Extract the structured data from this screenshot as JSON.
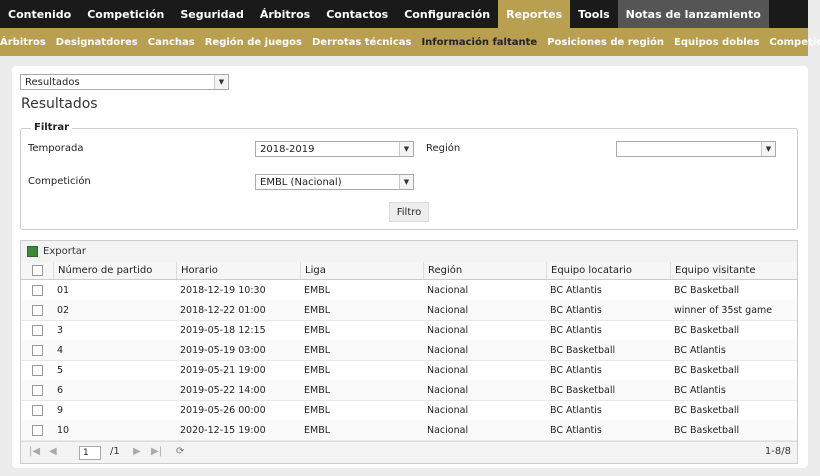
{
  "topnav": [
    "Contenido",
    "Competición",
    "Seguridad",
    "Árbitros",
    "Contactos",
    "Configuración",
    "Reportes",
    "Tools",
    "Notas de lanzamiento"
  ],
  "subnav": [
    "Árbitros",
    "Designatdores",
    "Canchas",
    "Región de juegos",
    "Derrotas técnicas",
    "Información faltante",
    "Posiciones de región",
    "Equipos dobles",
    "Competición"
  ],
  "report_select": "Resultados",
  "page_title": "Resultados",
  "filter": {
    "legend": "Filtrar",
    "season_label": "Temporada",
    "season_value": "2018-2019",
    "region_label": "Región",
    "region_value": "",
    "competition_label": "Competición",
    "competition_value": "EMBL (Nacional)",
    "button": "Filtro"
  },
  "grid": {
    "export": "Exportar",
    "columns": [
      "Número de partido",
      "Horario",
      "Liga",
      "Región",
      "Equipo locatario",
      "Equipo visitante"
    ],
    "rows": [
      [
        "01",
        "2018-12-19 10:30",
        "EMBL",
        "Nacional",
        "BC Atlantis",
        "BC Basketball"
      ],
      [
        "02",
        "2018-12-22 01:00",
        "EMBL",
        "Nacional",
        "BC Atlantis",
        "winner of 35st game"
      ],
      [
        "3",
        "2019-05-18 12:15",
        "EMBL",
        "Nacional",
        "BC Atlantis",
        "BC Basketball"
      ],
      [
        "4",
        "2019-05-19 03:00",
        "EMBL",
        "Nacional",
        "BC Basketball",
        "BC Atlantis"
      ],
      [
        "5",
        "2019-05-21 19:00",
        "EMBL",
        "Nacional",
        "BC Atlantis",
        "BC Basketball"
      ],
      [
        "6",
        "2019-05-22 14:00",
        "EMBL",
        "Nacional",
        "BC Basketball",
        "BC Atlantis"
      ],
      [
        "9",
        "2019-05-26 00:00",
        "EMBL",
        "Nacional",
        "BC Atlantis",
        "BC Basketball"
      ],
      [
        "10",
        "2020-12-15 19:00",
        "EMBL",
        "Nacional",
        "BC Atlantis",
        "BC Basketball"
      ]
    ],
    "pager": {
      "page": "1",
      "total": "/1",
      "range": "1-8/8"
    }
  }
}
